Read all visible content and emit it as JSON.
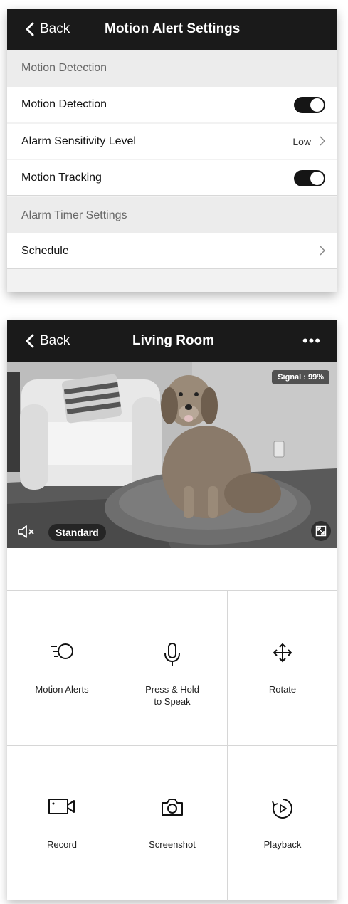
{
  "motion_settings": {
    "back_label": "Back",
    "title": "Motion Alert Settings",
    "section_motion": "Motion Detection",
    "motion_detection_label": "Motion Detection",
    "motion_detection_on": true,
    "sensitivity_label": "Alarm Sensitivity Level",
    "sensitivity_value": "Low",
    "motion_tracking_label": "Motion Tracking",
    "motion_tracking_on": true,
    "section_timer": "Alarm Timer Settings",
    "schedule_label": "Schedule"
  },
  "camera": {
    "back_label": "Back",
    "title": "Living Room",
    "more_label": "•••",
    "signal_text": "Signal : 99%",
    "quality_label": "Standard",
    "controls": [
      {
        "label": "Motion Alerts",
        "icon": "motion-alerts-icon"
      },
      {
        "label": "Press & Hold\nto Speak",
        "icon": "microphone-icon"
      },
      {
        "label": "Rotate",
        "icon": "rotate-arrows-icon"
      },
      {
        "label": "Record",
        "icon": "video-camera-icon"
      },
      {
        "label": "Screenshot",
        "icon": "camera-icon"
      },
      {
        "label": "Playback",
        "icon": "playback-icon"
      }
    ]
  },
  "colors": {
    "navbar": "#1a1a1a",
    "section_bg": "#ececec",
    "toggle_on": "#151515"
  }
}
